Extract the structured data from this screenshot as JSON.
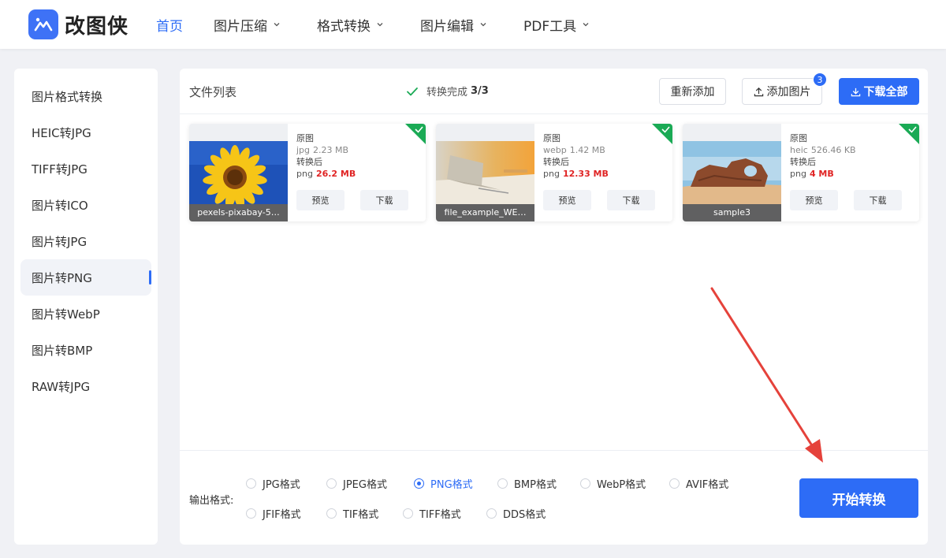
{
  "header": {
    "logo_text": "改图侠",
    "nav": [
      {
        "label": "首页",
        "active": true,
        "dropdown": false
      },
      {
        "label": "图片压缩",
        "active": false,
        "dropdown": true
      },
      {
        "label": "格式转换",
        "active": false,
        "dropdown": true
      },
      {
        "label": "图片编辑",
        "active": false,
        "dropdown": true
      },
      {
        "label": "PDF工具",
        "active": false,
        "dropdown": true
      }
    ]
  },
  "sidebar": {
    "items": [
      {
        "label": "图片格式转换"
      },
      {
        "label": "HEIC转JPG"
      },
      {
        "label": "TIFF转JPG"
      },
      {
        "label": "图片转ICO"
      },
      {
        "label": "图片转JPG"
      },
      {
        "label": "图片转PNG",
        "active": true
      },
      {
        "label": "图片转WebP"
      },
      {
        "label": "图片转BMP"
      },
      {
        "label": "RAW转JPG"
      }
    ]
  },
  "toolbar": {
    "title": "文件列表",
    "status_text": "转换完成",
    "status_count": "3/3",
    "readd_label": "重新添加",
    "add_label": "添加图片",
    "add_badge": "3",
    "download_all_label": "下载全部"
  },
  "files": [
    {
      "name": "pexels-pixabay-5…",
      "orig_label": "原图",
      "orig_format": "jpg",
      "orig_size": "2.23 MB",
      "conv_label": "转换后",
      "conv_format": "png",
      "conv_size": "26.2 MB",
      "preview_label": "预览",
      "download_label": "下载",
      "thumb": "sunflower-photo"
    },
    {
      "name": "file_example_WE…",
      "orig_label": "原图",
      "orig_format": "webp",
      "orig_size": "1.42 MB",
      "conv_label": "转换后",
      "conv_format": "png",
      "conv_size": "12.33 MB",
      "preview_label": "预览",
      "download_label": "下载",
      "thumb": "laptop-desk-photo"
    },
    {
      "name": "sample3",
      "orig_label": "原图",
      "orig_format": "heic",
      "orig_size": "526.46 KB",
      "conv_label": "转换后",
      "conv_format": "png",
      "conv_size": "4 MB",
      "preview_label": "预览",
      "download_label": "下载",
      "thumb": "desert-rock-photo"
    }
  ],
  "output": {
    "label": "输出格式:",
    "options": [
      {
        "label": "JPG格式",
        "checked": false
      },
      {
        "label": "JPEG格式",
        "checked": false
      },
      {
        "label": "PNG格式",
        "checked": true
      },
      {
        "label": "BMP格式",
        "checked": false
      },
      {
        "label": "WebP格式",
        "checked": false
      },
      {
        "label": "AVIF格式",
        "checked": false
      },
      {
        "label": "JFIF格式",
        "checked": false
      },
      {
        "label": "TIF格式",
        "checked": false
      },
      {
        "label": "TIFF格式",
        "checked": false
      },
      {
        "label": "DDS格式",
        "checked": false
      }
    ],
    "start_label": "开始转换"
  },
  "colors": {
    "accent": "#2d6cf6",
    "success": "#1aaa55",
    "size_red": "#e02424",
    "annotation_arrow": "#e5423b"
  }
}
